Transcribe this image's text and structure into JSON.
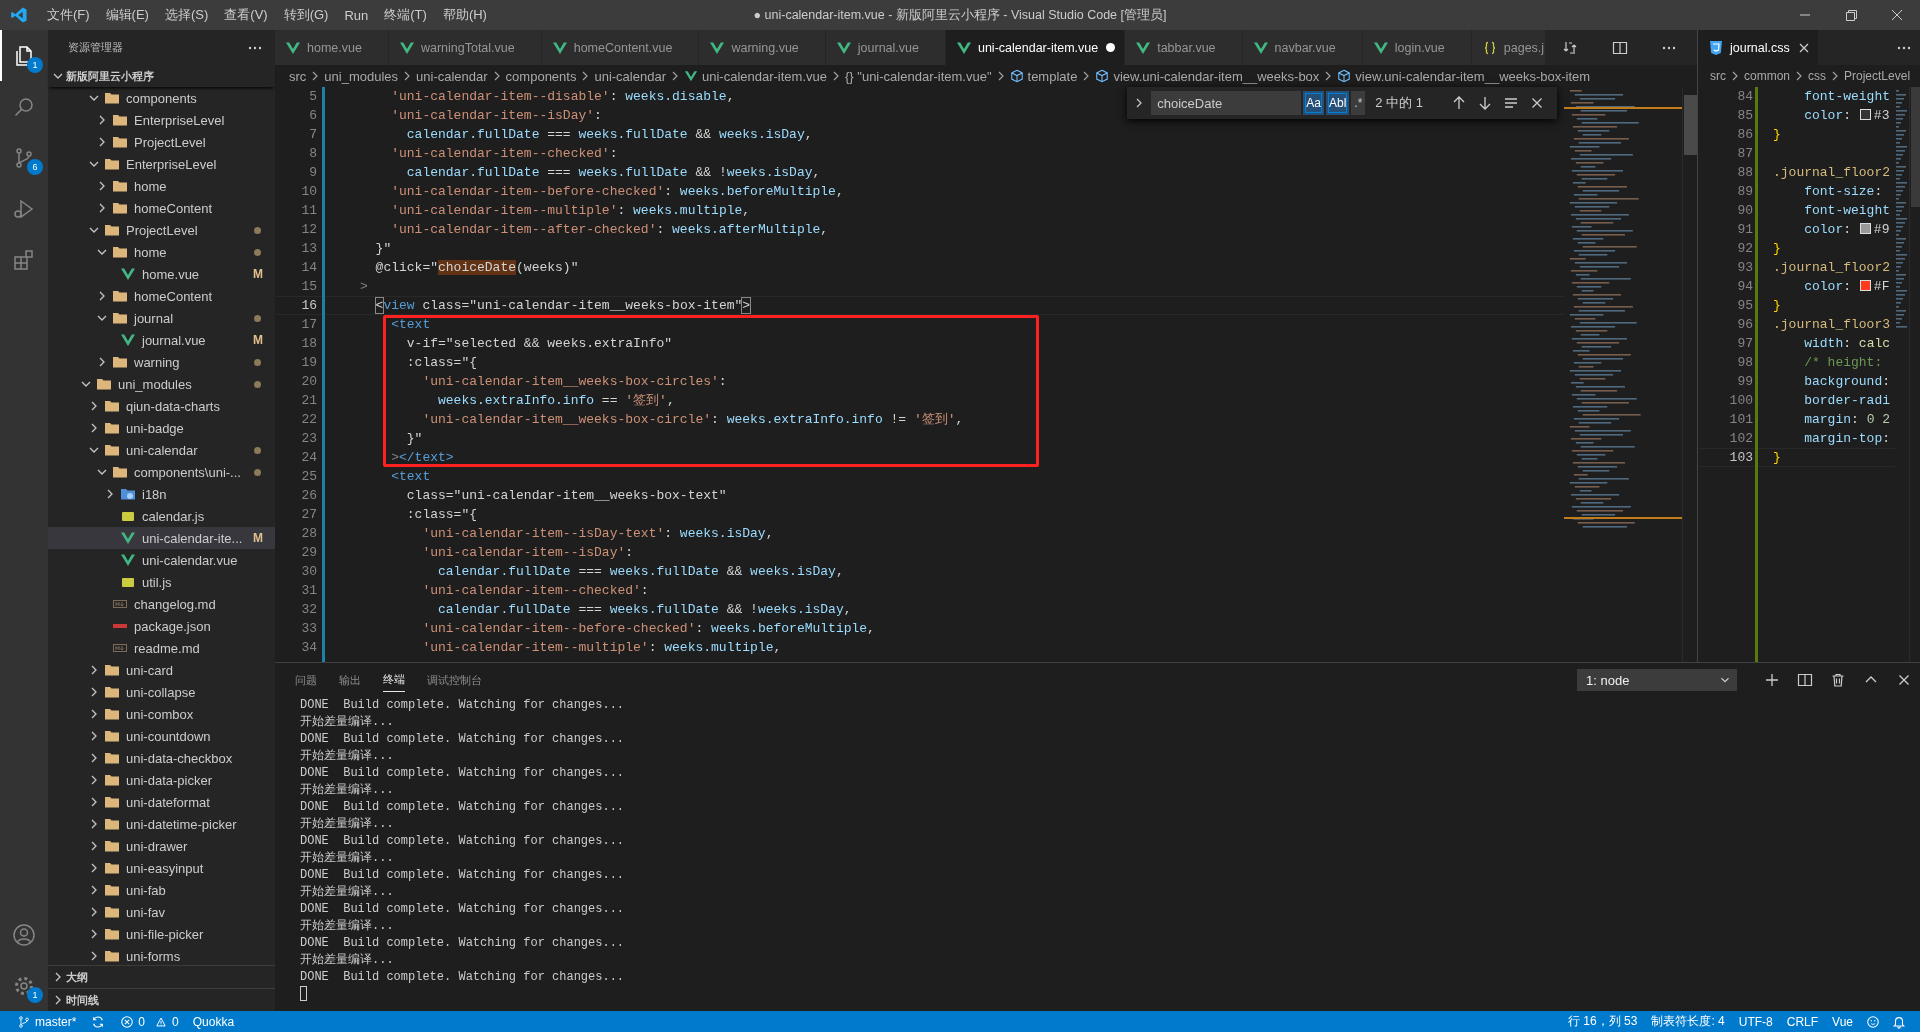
{
  "title_bar": {
    "menu": [
      "文件(F)",
      "编辑(E)",
      "选择(S)",
      "查看(V)",
      "转到(G)",
      "Run",
      "终端(T)",
      "帮助(H)"
    ],
    "title": "● uni-calendar-item.vue - 新版阿里云小程序 - Visual Studio Code [管理员]"
  },
  "activity_bar": {
    "items": [
      {
        "kind": "explorer",
        "selected": true,
        "badge": "1"
      },
      {
        "kind": "search",
        "selected": false
      },
      {
        "kind": "source-control",
        "selected": false,
        "badge": "6"
      },
      {
        "kind": "run",
        "selected": false
      },
      {
        "kind": "extensions",
        "selected": false
      }
    ],
    "bottom": [
      {
        "kind": "account"
      },
      {
        "kind": "settings",
        "badge": "1"
      }
    ]
  },
  "sidebar": {
    "title": "资源管理器",
    "root": "新版阿里云小程序",
    "tree": [
      {
        "expanded": true,
        "children": [
          {
            "label": "components",
            "kind": "folder",
            "expanded": true,
            "selected": false,
            "changed": false,
            "children": [
              {
                "label": "EnterpriseLevel",
                "kind": "folder",
                "expanded": false,
                "selected": false,
                "changed": false
              },
              {
                "label": "ProjectLevel",
                "kind": "folder",
                "expanded": false,
                "selected": false,
                "changed": false
              }
            ]
          },
          {
            "label": "EnterpriseLevel",
            "kind": "folder",
            "expanded": true,
            "selected": false,
            "changed": false,
            "children": [
              {
                "label": "home",
                "kind": "folder",
                "expanded": false,
                "selected": false,
                "changed": false
              },
              {
                "label": "homeContent",
                "kind": "folder",
                "expanded": false,
                "selected": false,
                "changed": false
              }
            ]
          },
          {
            "label": "ProjectLevel",
            "kind": "folder",
            "expanded": true,
            "selected": false,
            "changed": true,
            "children": [
              {
                "label": "home",
                "kind": "folder",
                "expanded": true,
                "selected": false,
                "changed": true,
                "children": [
                  {
                    "label": "home.vue",
                    "kind": "vue",
                    "selected": false,
                    "changed": true,
                    "badge": "M"
                  }
                ]
              },
              {
                "label": "homeContent",
                "kind": "folder",
                "expanded": false,
                "selected": false,
                "changed": false
              },
              {
                "label": "journal",
                "kind": "folder",
                "expanded": true,
                "selected": false,
                "changed": true,
                "children": [
                  {
                    "label": "journal.vue",
                    "kind": "vue",
                    "selected": false,
                    "changed": true,
                    "badge": "M"
                  }
                ]
              },
              {
                "label": "warning",
                "kind": "folder",
                "expanded": false,
                "selected": false,
                "changed": true
              }
            ]
          }
        ]
      },
      {
        "label": "uni_modules",
        "kind": "folder",
        "expanded": true,
        "selected": false,
        "changed": true,
        "children": [
          {
            "label": "qiun-data-charts",
            "kind": "folder",
            "expanded": false,
            "selected": false,
            "changed": false
          },
          {
            "label": "uni-badge",
            "kind": "folder",
            "expanded": false,
            "selected": false,
            "changed": false
          },
          {
            "label": "uni-calendar",
            "kind": "folder",
            "expanded": true,
            "selected": false,
            "changed": true,
            "children": [
              {
                "label": "components\\uni-...",
                "kind": "folder",
                "expanded": true,
                "selected": false,
                "changed": true,
                "children": [
                  {
                    "label": "i18n",
                    "kind": "folder-i18n",
                    "expanded": false,
                    "selected": false,
                    "changed": false
                  },
                  {
                    "label": "calendar.js",
                    "kind": "js",
                    "selected": false,
                    "changed": false
                  },
                  {
                    "label": "uni-calendar-ite...",
                    "kind": "vue",
                    "selected": true,
                    "changed": true,
                    "badge": "M"
                  },
                  {
                    "label": "uni-calendar.vue",
                    "kind": "vue",
                    "selected": false,
                    "changed": false
                  },
                  {
                    "label": "util.js",
                    "kind": "js",
                    "selected": false,
                    "changed": false
                  }
                ]
              },
              {
                "label": "changelog.md",
                "kind": "md",
                "selected": false,
                "changed": false
              },
              {
                "label": "package.json",
                "kind": "npm",
                "selected": false,
                "changed": false
              },
              {
                "label": "readme.md",
                "kind": "md",
                "selected": false,
                "changed": false
              }
            ]
          },
          {
            "label": "uni-card",
            "kind": "folder",
            "expanded": false,
            "selected": false,
            "changed": false
          },
          {
            "label": "uni-collapse",
            "kind": "folder",
            "expanded": false,
            "selected": false,
            "changed": false
          },
          {
            "label": "uni-combox",
            "kind": "folder",
            "expanded": false,
            "selected": false,
            "changed": false
          },
          {
            "label": "uni-countdown",
            "kind": "folder",
            "expanded": false,
            "selected": false,
            "changed": false
          },
          {
            "label": "uni-data-checkbox",
            "kind": "folder",
            "expanded": false,
            "selected": false,
            "changed": false
          },
          {
            "label": "uni-data-picker",
            "kind": "folder",
            "expanded": false,
            "selected": false,
            "changed": false
          },
          {
            "label": "uni-dateformat",
            "kind": "folder",
            "expanded": false,
            "selected": false,
            "changed": false
          },
          {
            "label": "uni-datetime-picker",
            "kind": "folder",
            "expanded": false,
            "selected": false,
            "changed": false
          },
          {
            "label": "uni-drawer",
            "kind": "folder",
            "expanded": false,
            "selected": false,
            "changed": false
          },
          {
            "label": "uni-easyinput",
            "kind": "folder",
            "expanded": false,
            "selected": false,
            "changed": false
          },
          {
            "label": "uni-fab",
            "kind": "folder",
            "expanded": false,
            "selected": false,
            "changed": false
          },
          {
            "label": "uni-fav",
            "kind": "folder",
            "expanded": false,
            "selected": false,
            "changed": false
          },
          {
            "label": "uni-file-picker",
            "kind": "folder",
            "expanded": false,
            "selected": false,
            "changed": false
          },
          {
            "label": "uni-forms",
            "kind": "folder",
            "expanded": false,
            "selected": false,
            "changed": false
          }
        ]
      }
    ],
    "sections": [
      "大纲",
      "时间线"
    ]
  },
  "editor": {
    "tabs": [
      {
        "label": "home.vue",
        "kind": "vue",
        "selected": false,
        "dirty": false
      },
      {
        "label": "warningTotal.vue",
        "kind": "vue",
        "selected": false,
        "dirty": false
      },
      {
        "label": "homeContent.vue",
        "kind": "vue",
        "selected": false,
        "dirty": false
      },
      {
        "label": "warning.vue",
        "kind": "vue",
        "selected": false,
        "dirty": false
      },
      {
        "label": "journal.vue",
        "kind": "vue",
        "selected": false,
        "dirty": false
      },
      {
        "label": "uni-calendar-item.vue",
        "kind": "vue",
        "selected": true,
        "dirty": true
      },
      {
        "label": "tabbar.vue",
        "kind": "vue",
        "selected": false,
        "dirty": false
      },
      {
        "label": "navbar.vue",
        "kind": "vue",
        "selected": false,
        "dirty": false
      },
      {
        "label": "login.vue",
        "kind": "vue",
        "selected": false,
        "dirty": false
      },
      {
        "label": "pages.j",
        "kind": "json",
        "selected": false,
        "dirty": false
      }
    ],
    "breadcrumbs": [
      {
        "label": "src",
        "kind": "folder"
      },
      {
        "label": "uni_modules",
        "kind": "folder"
      },
      {
        "label": "uni-calendar",
        "kind": "folder"
      },
      {
        "label": "components",
        "kind": "folder"
      },
      {
        "label": "uni-calendar",
        "kind": "folder"
      },
      {
        "label": "uni-calendar-item.vue",
        "kind": "vue"
      },
      {
        "label": "{} \"uni-calendar-item.vue\"",
        "kind": "folder"
      },
      {
        "label": "template",
        "kind": "symbol"
      },
      {
        "label": "view.uni-calendar-item__weeks-box",
        "kind": "symbol"
      },
      {
        "label": "view.uni-calendar-item__weeks-box-item",
        "kind": "symbol"
      }
    ],
    "find": {
      "value": "choiceDate",
      "toggles": [
        {
          "label": "Aa",
          "on": true
        },
        {
          "label": "Abl",
          "on": true
        },
        {
          "label": ".*",
          "on": false
        }
      ],
      "result": "2 中的 1"
    },
    "change_bar": {
      "kind": "modified"
    },
    "groups": [
      {
        "marked": false,
        "lines": [
          {
            "number": "5",
            "current": false,
            "segments": [
              {
                "kind": "string",
                "text": "    'uni-calendar-item--disable'"
              },
              {
                "kind": "plain",
                "text": ": "
              },
              {
                "kind": "variable",
                "text": "weeks.disable"
              },
              {
                "kind": "plain",
                "text": ","
              }
            ]
          },
          {
            "number": "6",
            "current": false,
            "segments": [
              {
                "kind": "string",
                "text": "    'uni-calendar-item--isDay'"
              },
              {
                "kind": "plain",
                "text": ":"
              }
            ]
          },
          {
            "number": "7",
            "current": false,
            "segments": [
              {
                "kind": "variable",
                "text": "      calendar.fullDate"
              },
              {
                "kind": "plain",
                "text": " === "
              },
              {
                "kind": "variable",
                "text": "weeks.fullDate"
              },
              {
                "kind": "plain",
                "text": " && "
              },
              {
                "kind": "variable",
                "text": "weeks.isDay"
              },
              {
                "kind": "plain",
                "text": ","
              }
            ]
          },
          {
            "number": "8",
            "current": false,
            "segments": [
              {
                "kind": "string",
                "text": "    'uni-calendar-item--checked'"
              },
              {
                "kind": "plain",
                "text": ":"
              }
            ]
          },
          {
            "number": "9",
            "current": false,
            "segments": [
              {
                "kind": "variable",
                "text": "      calendar.fullDate"
              },
              {
                "kind": "plain",
                "text": " === "
              },
              {
                "kind": "variable",
                "text": "weeks.fullDate"
              },
              {
                "kind": "plain",
                "text": " && !"
              },
              {
                "kind": "variable",
                "text": "weeks.isDay"
              },
              {
                "kind": "plain",
                "text": ","
              }
            ]
          },
          {
            "number": "10",
            "current": false,
            "segments": [
              {
                "kind": "string",
                "text": "    'uni-calendar-item--before-checked'"
              },
              {
                "kind": "plain",
                "text": ": "
              },
              {
                "kind": "variable",
                "text": "weeks.beforeMultiple"
              },
              {
                "kind": "plain",
                "text": ","
              }
            ]
          },
          {
            "number": "11",
            "current": false,
            "segments": [
              {
                "kind": "string",
                "text": "    'uni-calendar-item--multiple'"
              },
              {
                "kind": "plain",
                "text": ": "
              },
              {
                "kind": "variable",
                "text": "weeks.multiple"
              },
              {
                "kind": "plain",
                "text": ","
              }
            ]
          },
          {
            "number": "12",
            "current": false,
            "segments": [
              {
                "kind": "string",
                "text": "    'uni-calendar-item--after-checked'"
              },
              {
                "kind": "plain",
                "text": ": "
              },
              {
                "kind": "variable",
                "text": "weeks.afterMultiple"
              },
              {
                "kind": "plain",
                "text": ","
              }
            ]
          },
          {
            "number": "13",
            "current": false,
            "segments": [
              {
                "kind": "plain",
                "text": "  }\""
              }
            ]
          },
          {
            "number": "14",
            "current": false,
            "segments": [
              {
                "kind": "plain",
                "text": "  @click=\""
              },
              {
                "kind": "match",
                "text": "choiceDate"
              },
              {
                "kind": "plain",
                "text": "(weeks)\""
              }
            ]
          },
          {
            "number": "15",
            "current": false,
            "segments": [
              {
                "kind": "punct",
                "text": ">"
              }
            ]
          },
          {
            "number": "16",
            "current": true,
            "segments": [
              {
                "kind": "bracket",
                "text": "  <"
              },
              {
                "kind": "tag",
                "text": "view"
              },
              {
                "kind": "plain",
                "text": " class=\"uni-calendar-item__weeks-box-item\""
              },
              {
                "kind": "bracket",
                "text": ">"
              }
            ]
          }
        ]
      },
      {
        "marked": true,
        "lines": [
          {
            "number": "17",
            "current": false,
            "segments": [
              {
                "kind": "tag",
                "text": "    <text"
              }
            ]
          },
          {
            "number": "18",
            "current": false,
            "segments": [
              {
                "kind": "plain",
                "text": "      v-if=\"selected && weeks.extraInfo\""
              }
            ]
          },
          {
            "number": "19",
            "current": false,
            "segments": [
              {
                "kind": "plain",
                "text": "      :class=\"{"
              }
            ]
          },
          {
            "number": "20",
            "current": false,
            "segments": [
              {
                "kind": "string",
                "text": "        'uni-calendar-item__weeks-box-circles'"
              },
              {
                "kind": "plain",
                "text": ":"
              }
            ]
          },
          {
            "number": "21",
            "current": false,
            "segments": [
              {
                "kind": "variable",
                "text": "          weeks.extraInfo.info"
              },
              {
                "kind": "plain",
                "text": " == "
              },
              {
                "kind": "string",
                "text": "'签到'"
              },
              {
                "kind": "plain",
                "text": ","
              }
            ]
          },
          {
            "number": "22",
            "current": false,
            "segments": [
              {
                "kind": "string",
                "text": "        'uni-calendar-item__weeks-box-circle'"
              },
              {
                "kind": "plain",
                "text": ": "
              },
              {
                "kind": "variable",
                "text": "weeks.extraInfo.info"
              },
              {
                "kind": "plain",
                "text": " != "
              },
              {
                "kind": "string",
                "text": "'签到'"
              },
              {
                "kind": "plain",
                "text": ","
              }
            ]
          },
          {
            "number": "23",
            "current": false,
            "segments": [
              {
                "kind": "plain",
                "text": "      }\""
              }
            ]
          },
          {
            "number": "24",
            "current": false,
            "segments": [
              {
                "kind": "punct",
                "text": "    >"
              },
              {
                "kind": "tag",
                "text": "</text>"
              }
            ]
          }
        ]
      },
      {
        "marked": false,
        "lines": [
          {
            "number": "25",
            "current": false,
            "segments": [
              {
                "kind": "tag",
                "text": "    <text"
              }
            ]
          },
          {
            "number": "26",
            "current": false,
            "segments": [
              {
                "kind": "plain",
                "text": "      class=\"uni-calendar-item__weeks-box-text\""
              }
            ]
          },
          {
            "number": "27",
            "current": false,
            "segments": [
              {
                "kind": "plain",
                "text": "      :class=\"{"
              }
            ]
          },
          {
            "number": "28",
            "current": false,
            "segments": [
              {
                "kind": "string",
                "text": "        'uni-calendar-item--isDay-text'"
              },
              {
                "kind": "plain",
                "text": ": "
              },
              {
                "kind": "variable",
                "text": "weeks.isDay"
              },
              {
                "kind": "plain",
                "text": ","
              }
            ]
          },
          {
            "number": "29",
            "current": false,
            "segments": [
              {
                "kind": "string",
                "text": "        'uni-calendar-item--isDay'"
              },
              {
                "kind": "plain",
                "text": ":"
              }
            ]
          },
          {
            "number": "30",
            "current": false,
            "segments": [
              {
                "kind": "variable",
                "text": "          calendar.fullDate"
              },
              {
                "kind": "plain",
                "text": " === "
              },
              {
                "kind": "variable",
                "text": "weeks.fullDate"
              },
              {
                "kind": "plain",
                "text": " && "
              },
              {
                "kind": "variable",
                "text": "weeks.isDay"
              },
              {
                "kind": "plain",
                "text": ","
              }
            ]
          },
          {
            "number": "31",
            "current": false,
            "segments": [
              {
                "kind": "string",
                "text": "        'uni-calendar-item--checked'"
              },
              {
                "kind": "plain",
                "text": ":"
              }
            ]
          },
          {
            "number": "32",
            "current": false,
            "segments": [
              {
                "kind": "variable",
                "text": "          calendar.fullDate"
              },
              {
                "kind": "plain",
                "text": " === "
              },
              {
                "kind": "variable",
                "text": "weeks.fullDate"
              },
              {
                "kind": "plain",
                "text": " && !"
              },
              {
                "kind": "variable",
                "text": "weeks.isDay"
              },
              {
                "kind": "plain",
                "text": ","
              }
            ]
          },
          {
            "number": "33",
            "current": false,
            "segments": [
              {
                "kind": "string",
                "text": "        'uni-calendar-item--before-checked'"
              },
              {
                "kind": "plain",
                "text": ": "
              },
              {
                "kind": "variable",
                "text": "weeks.beforeMultiple"
              },
              {
                "kind": "plain",
                "text": ","
              }
            ]
          },
          {
            "number": "34",
            "current": false,
            "segments": [
              {
                "kind": "string",
                "text": "        'uni-calendar-item--multiple'"
              },
              {
                "kind": "plain",
                "text": ": "
              },
              {
                "kind": "variable",
                "text": "weeks.multiple"
              },
              {
                "kind": "plain",
                "text": ","
              }
            ]
          }
        ]
      }
    ]
  },
  "right_editor": {
    "tab": {
      "label": "journal.css",
      "kind": "css",
      "selected": true
    },
    "breadcrumbs": [
      "src",
      "common",
      "css",
      "ProjectLevel"
    ],
    "change_bar": {
      "kind": "added"
    },
    "lines": [
      {
        "number": "84",
        "current": false,
        "segments": [
          {
            "kind": "variable",
            "text": "    font-weight"
          }
        ]
      },
      {
        "number": "85",
        "current": false,
        "segments": [
          {
            "kind": "variable",
            "text": "    color"
          },
          {
            "kind": "plain",
            "text": ": "
          },
          {
            "kind": "swatch",
            "color": "#333333"
          },
          {
            "kind": "plain",
            "text": "#3"
          }
        ]
      },
      {
        "number": "86",
        "current": false,
        "segments": [
          {
            "kind": "brace",
            "text": "}"
          }
        ]
      },
      {
        "number": "87",
        "current": false
      },
      {
        "number": "88",
        "current": false,
        "segments": [
          {
            "kind": "selector",
            "text": ".journal_floor2"
          }
        ]
      },
      {
        "number": "89",
        "current": false,
        "segments": [
          {
            "kind": "variable",
            "text": "    font-size"
          },
          {
            "kind": "plain",
            "text": ":"
          }
        ]
      },
      {
        "number": "90",
        "current": false,
        "segments": [
          {
            "kind": "variable",
            "text": "    font-weight"
          }
        ]
      },
      {
        "number": "91",
        "current": false,
        "segments": [
          {
            "kind": "variable",
            "text": "    color"
          },
          {
            "kind": "plain",
            "text": ": "
          },
          {
            "kind": "swatch",
            "color": "#999999"
          },
          {
            "kind": "plain",
            "text": "#9"
          }
        ]
      },
      {
        "number": "92",
        "current": false,
        "segments": [
          {
            "kind": "brace",
            "text": "}"
          }
        ]
      },
      {
        "number": "93",
        "current": false,
        "segments": [
          {
            "kind": "selector",
            "text": ".journal_floor2"
          }
        ]
      },
      {
        "number": "94",
        "current": false,
        "segments": [
          {
            "kind": "variable",
            "text": "    color"
          },
          {
            "kind": "plain",
            "text": ": "
          },
          {
            "kind": "swatch",
            "color": "#ff3b1f"
          },
          {
            "kind": "plain",
            "text": "#F"
          }
        ]
      },
      {
        "number": "95",
        "current": false,
        "segments": [
          {
            "kind": "brace",
            "text": "}"
          }
        ]
      },
      {
        "number": "96",
        "current": false,
        "segments": [
          {
            "kind": "selector",
            "text": ".journal_floor3"
          }
        ]
      },
      {
        "number": "97",
        "current": false,
        "segments": [
          {
            "kind": "variable",
            "text": "    width"
          },
          {
            "kind": "plain",
            "text": ": "
          },
          {
            "kind": "function",
            "text": "calc"
          }
        ]
      },
      {
        "number": "98",
        "current": false,
        "segments": [
          {
            "kind": "comment",
            "text": "    /* height:"
          }
        ]
      },
      {
        "number": "99",
        "current": false,
        "segments": [
          {
            "kind": "variable",
            "text": "    background"
          },
          {
            "kind": "plain",
            "text": ":"
          }
        ]
      },
      {
        "number": "100",
        "current": false,
        "segments": [
          {
            "kind": "variable",
            "text": "    border-radi"
          }
        ]
      },
      {
        "number": "101",
        "current": false,
        "segments": [
          {
            "kind": "variable",
            "text": "    margin"
          },
          {
            "kind": "plain",
            "text": ": "
          },
          {
            "kind": "number",
            "text": "0 2"
          }
        ]
      },
      {
        "number": "102",
        "current": false,
        "segments": [
          {
            "kind": "variable",
            "text": "    margin-top"
          },
          {
            "kind": "plain",
            "text": ":"
          }
        ]
      },
      {
        "number": "103",
        "current": true,
        "segments": [
          {
            "kind": "brace",
            "text": "}"
          }
        ]
      }
    ]
  },
  "panel": {
    "tabs": [
      {
        "label": "问题",
        "selected": false
      },
      {
        "label": "输出",
        "selected": false
      },
      {
        "label": "终端",
        "selected": true
      },
      {
        "label": "调试控制台",
        "selected": false
      }
    ],
    "terminal_select": "1: node",
    "lines": [
      "DONE  Build complete. Watching for changes...",
      "开始差量编译...",
      "DONE  Build complete. Watching for changes...",
      "开始差量编译...",
      "DONE  Build complete. Watching for changes...",
      "开始差量编译...",
      "DONE  Build complete. Watching for changes...",
      "开始差量编译...",
      "DONE  Build complete. Watching for changes...",
      "开始差量编译...",
      "DONE  Build complete. Watching for changes...",
      "开始差量编译...",
      "DONE  Build complete. Watching for changes...",
      "开始差量编译...",
      "DONE  Build complete. Watching for changes...",
      "开始差量编译...",
      "DONE  Build complete. Watching for changes..."
    ]
  },
  "status_bar": {
    "branch": "master*",
    "errors": "0",
    "warnings": "0",
    "left": [
      "Quokka"
    ],
    "right": [
      "行 16，列 53",
      "制表符长度: 4",
      "UTF-8",
      "CRLF",
      "Vue"
    ]
  }
}
